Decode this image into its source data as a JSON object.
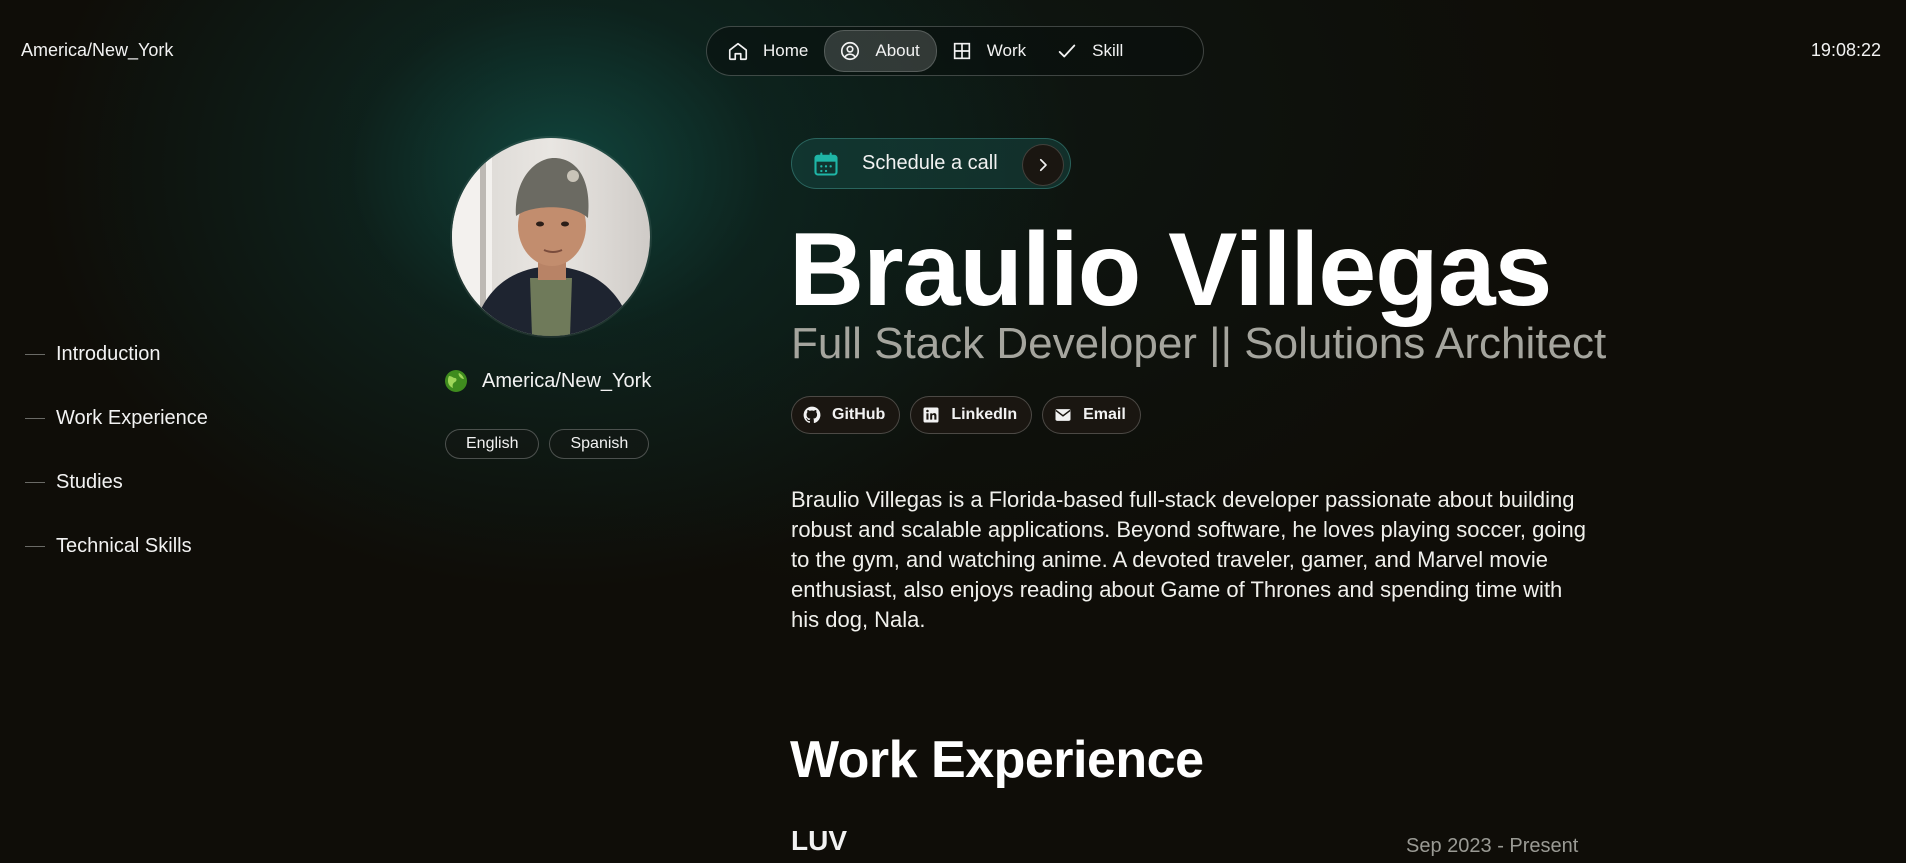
{
  "header": {
    "timezone": "America/New_York",
    "clock": "19:08:22",
    "nav": [
      {
        "label": "Home",
        "icon": "home-icon"
      },
      {
        "label": "About",
        "icon": "user-circle-icon",
        "active": true
      },
      {
        "label": "Work",
        "icon": "grid-icon"
      },
      {
        "label": "Skill",
        "icon": "check-icon"
      }
    ]
  },
  "sidebar": {
    "items": [
      {
        "label": "Introduction"
      },
      {
        "label": "Work Experience"
      },
      {
        "label": "Studies"
      },
      {
        "label": "Technical Skills"
      }
    ]
  },
  "profile": {
    "location": "America/New_York",
    "languages": [
      "English",
      "Spanish"
    ]
  },
  "hero": {
    "schedule_label": "Schedule a call",
    "name": "Braulio Villegas",
    "role": "Full Stack Developer || Solutions Architect",
    "socials": [
      {
        "label": "GitHub",
        "icon": "github-icon"
      },
      {
        "label": "LinkedIn",
        "icon": "linkedin-icon"
      },
      {
        "label": "Email",
        "icon": "mail-icon"
      }
    ],
    "bio": "Braulio Villegas is a Florida-based full-stack developer passionate about building robust and scalable applications. Beyond software, he loves playing soccer, going to the gym, and watching anime. A devoted traveler, gamer, and Marvel movie enthusiast, also enjoys reading about Game of Thrones and spending time with his dog, Nala."
  },
  "work": {
    "title": "Work Experience",
    "entries": [
      {
        "company": "LUV",
        "period": "Sep 2023 - Present"
      }
    ]
  },
  "colors": {
    "background": "#0f0d08",
    "accent_teal": "#1a8a80",
    "muted_text": "#a5a59e"
  }
}
